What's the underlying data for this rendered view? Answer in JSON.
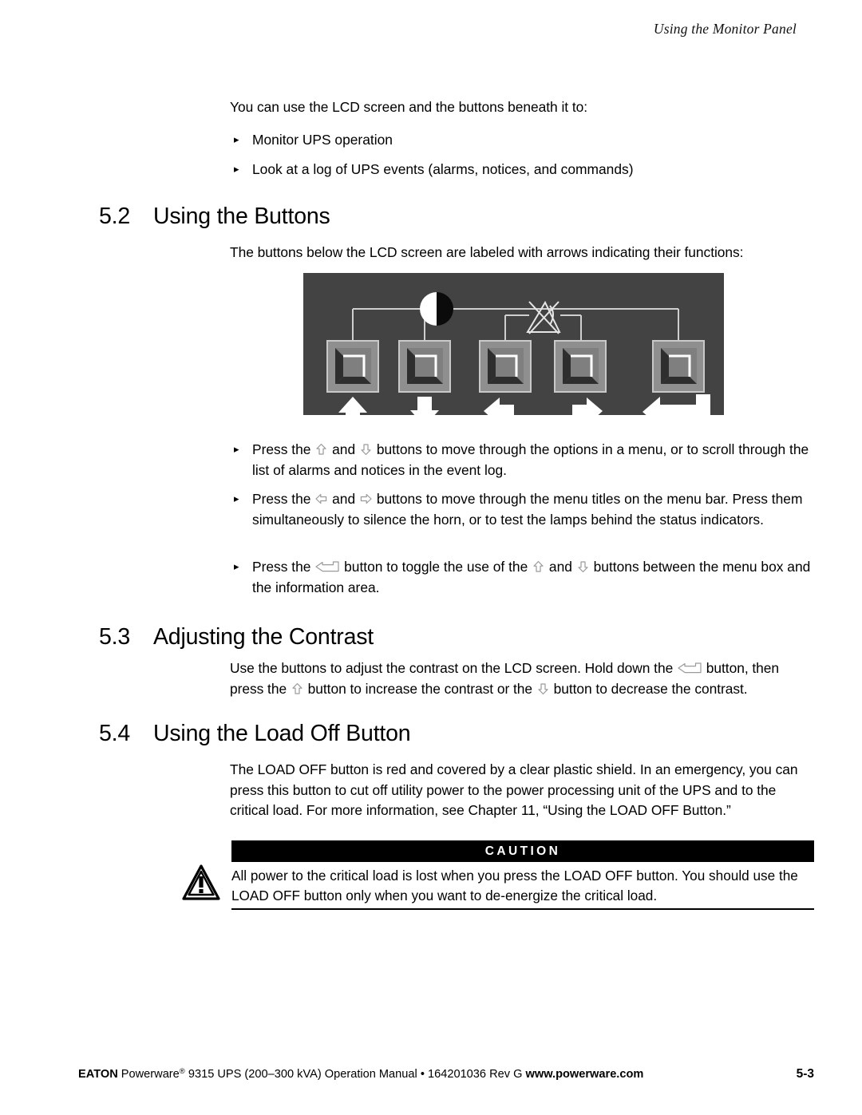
{
  "page": {
    "running_head": "Using the Monitor Panel",
    "footer": {
      "brand": "EATON",
      "product": " Powerware",
      "registered": "®",
      "details": " 9315 UPS (200–300 kVA) Operation Manual  •  164201036 Rev G  ",
      "url": "www.powerware.com",
      "page_number": "5-3"
    }
  },
  "intro": {
    "lead": "You can use the LCD screen and the buttons beneath it to:",
    "bullets": [
      "Monitor UPS operation",
      "Look at a log of UPS events (alarms, notices, and commands)"
    ],
    "bullet_marker": "▸"
  },
  "sections": [
    {
      "number": "5.2",
      "title": "Using the Buttons",
      "lead": "The buttons below the LCD screen are labeled with arrows indicating their functions:",
      "bullets": [
        {
          "parts": [
            {
              "type": "text",
              "value": "Press the "
            },
            {
              "type": "glyph",
              "value": "arrow-up-outline"
            },
            {
              "type": "text",
              "value": " and "
            },
            {
              "type": "glyph",
              "value": "arrow-down-outline"
            },
            {
              "type": "text",
              "value": " buttons to move through the options in a menu, or to scroll through the list of alarms and notices in the event log."
            }
          ]
        },
        {
          "parts": [
            {
              "type": "text",
              "value": "Press the "
            },
            {
              "type": "glyph",
              "value": "arrow-left-outline"
            },
            {
              "type": "text",
              "value": " and "
            },
            {
              "type": "glyph",
              "value": "arrow-right-outline"
            },
            {
              "type": "text",
              "value": " buttons to move through the menu titles on the menu bar. Press them simultaneously to silence the horn, or to test the lamps behind the status indicators."
            }
          ]
        },
        {
          "parts": [
            {
              "type": "text",
              "value": "Press the "
            },
            {
              "type": "glyph",
              "value": "enter-return-outline"
            },
            {
              "type": "text",
              "value": " button to toggle the use of the "
            },
            {
              "type": "glyph",
              "value": "arrow-up-outline"
            },
            {
              "type": "text",
              "value": " and "
            },
            {
              "type": "glyph",
              "value": "arrow-down-outline"
            },
            {
              "type": "text",
              "value": " buttons between the menu box and the information area."
            }
          ]
        }
      ]
    },
    {
      "number": "5.3",
      "title": "Adjusting the Contrast",
      "paragraph_parts": [
        {
          "type": "text",
          "value": "Use the buttons to adjust the contrast on the LCD screen. Hold down the "
        },
        {
          "type": "glyph",
          "value": "enter-return-outline"
        },
        {
          "type": "text",
          "value": " button, then press the "
        },
        {
          "type": "glyph",
          "value": "arrow-up-outline"
        },
        {
          "type": "text",
          "value": " button to increase the contrast or the "
        },
        {
          "type": "glyph",
          "value": "arrow-down-outline"
        },
        {
          "type": "text",
          "value": " button to decrease the contrast."
        }
      ]
    },
    {
      "number": "5.4",
      "title": "Using the Load Off Button",
      "paragraph": "The LOAD OFF button is red and covered by a clear plastic shield. In an emergency, you can press this button to cut off utility power to the power processing unit of the UPS and to the critical load. For more information, see Chapter 11, “Using the LOAD OFF Button.”"
    }
  ],
  "caution": {
    "label": "CAUTION",
    "icon": "warning-triangle-icon",
    "text": "All power to the critical load is lost when you press the LOAD OFF button. You should use the LOAD OFF button only when you want to de-energize the critical load."
  },
  "monitor_panel": {
    "alt": "Monitor panel with five buttons labeled with arrows",
    "background_color": "#434343",
    "button_face_color": "#8c8c8c",
    "button_inner_color": "#7d7d7d",
    "arrow_color": "#ffffff",
    "buttons": [
      {
        "name": "up-button",
        "arrow": "arrow-up-solid"
      },
      {
        "name": "down-button",
        "arrow": "arrow-down-solid"
      },
      {
        "name": "left-button",
        "arrow": "arrow-left-solid"
      },
      {
        "name": "right-button",
        "arrow": "arrow-right-solid"
      },
      {
        "name": "enter-button",
        "arrow": "arrow-enter-solid"
      }
    ],
    "indicators": [
      {
        "name": "contrast-icon",
        "description": "half-filled circle contrast symbol"
      },
      {
        "name": "horn-silence-icon",
        "description": "crossed-out horn symbol"
      }
    ]
  }
}
